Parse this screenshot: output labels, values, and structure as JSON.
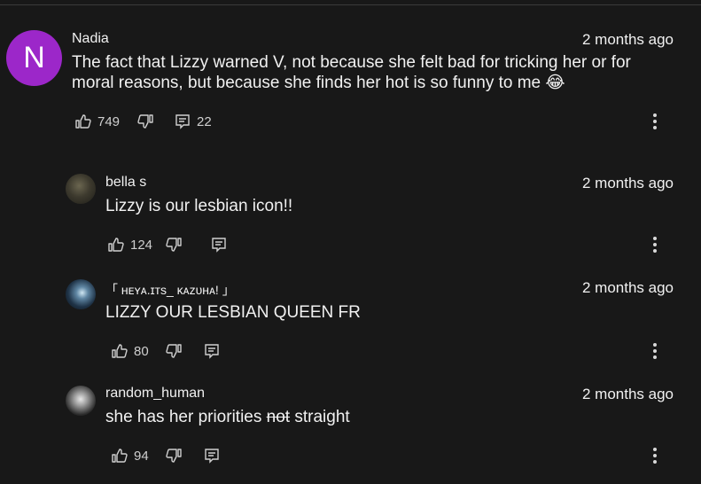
{
  "comments": [
    {
      "author": "Nadia",
      "avatar_letter": "N",
      "time": "2 months ago",
      "text": "The fact that Lizzy warned V, not because she felt bad for tricking her or for moral reasons, but because she finds her hot is so funny to me 😂",
      "likes": "749",
      "replies": "22"
    },
    {
      "author": "bella s",
      "time": "2 months ago",
      "text": "Lizzy is our lesbian icon!!",
      "likes": "124"
    },
    {
      "author": "「 ʜᴇʏᴀ.ɪᴛs_ ᴋᴀᴢᴜʜᴀ! 」",
      "time": "2 months ago",
      "text": "LIZZY OUR LESBIAN QUEEN FR",
      "likes": "80"
    },
    {
      "author": "random_human",
      "time": "2 months ago",
      "text_before": "she has her priorities ",
      "text_struck": "not",
      "text_after": " straight",
      "likes": "94"
    }
  ],
  "colors": {
    "background": "#181818",
    "avatar_main": "#9c27c9",
    "text": "#f1f1f1"
  },
  "icons": [
    "thumbs-up-icon",
    "thumbs-down-icon",
    "reply-icon",
    "more-vert-icon"
  ]
}
